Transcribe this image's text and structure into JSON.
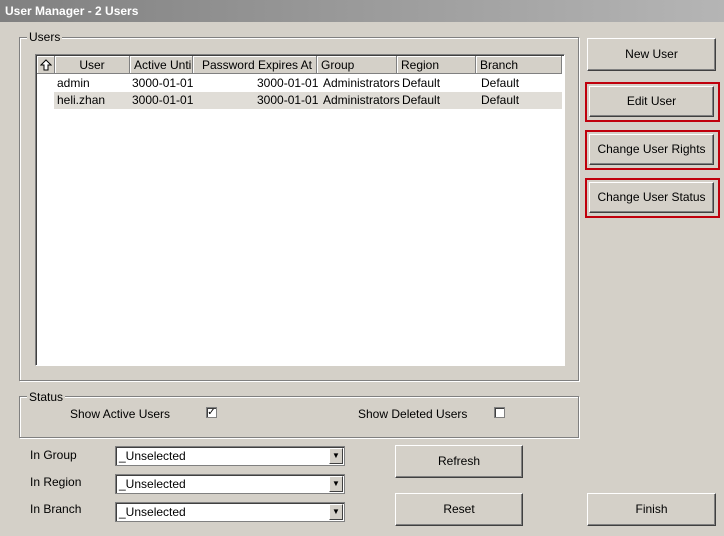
{
  "window": {
    "title": "User Manager - 2 Users"
  },
  "users_group": {
    "legend": "Users",
    "columns": [
      "User",
      "Active Until",
      "Password Expires At",
      "Group",
      "Region",
      "Branch"
    ],
    "sort_icon": "sort-up-arrow-icon",
    "rows": [
      {
        "user": "admin",
        "active_until": "3000-01-01",
        "password_expires": "3000-01-01",
        "group": "Administrators",
        "region": "Default",
        "branch": "Default"
      },
      {
        "user": "heli.zhan",
        "active_until": "3000-01-01",
        "password_expires": "3000-01-01",
        "group": "Administrators",
        "region": "Default",
        "branch": "Default"
      }
    ]
  },
  "status_group": {
    "legend": "Status",
    "show_active_label": "Show Active Users",
    "show_active_checked": true,
    "show_deleted_label": "Show Deleted Users",
    "show_deleted_checked": false
  },
  "filters": {
    "in_group_label": "In Group",
    "in_group_value": "_Unselected",
    "in_region_label": "In Region",
    "in_region_value": "_Unselected",
    "in_branch_label": "In Branch",
    "in_branch_value": "_Unselected"
  },
  "buttons": {
    "new_user": "New User",
    "edit_user": "Edit User",
    "change_rights": "Change User Rights",
    "change_status": "Change User Status",
    "refresh": "Refresh",
    "reset": "Reset",
    "finish": "Finish"
  },
  "colors": {
    "highlight_border": "#c0000c",
    "title_gradient_start": "#808080",
    "dialog_bg": "#d4d0c8"
  }
}
